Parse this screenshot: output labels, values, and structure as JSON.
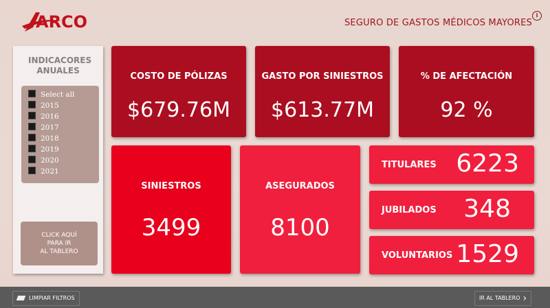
{
  "header": {
    "logo_text": "ARCO",
    "title": "SEGURO DE GASTOS MÉDICOS MAYORES",
    "info_icon": "info-icon"
  },
  "colors": {
    "dark": "#ab0e20",
    "red": "#e8001d",
    "pink": "#f01f3d",
    "brand": "#c1121c"
  },
  "sidebar": {
    "title": "INDICACORES ANUALES",
    "slicer": [
      "Select all",
      "2015",
      "2016",
      "2017",
      "2018",
      "2019",
      "2020",
      "2021"
    ],
    "go_button": "CLICK AQUÍ\nPARA IR\nAL TABLERO"
  },
  "kpis": {
    "costo": {
      "label": "COSTO DE PÓLIZAS",
      "value": "$679.76M"
    },
    "gasto": {
      "label": "GASTO POR SINIESTROS",
      "value": "$613.77M"
    },
    "afectacion": {
      "label": "% DE AFECTACIÓN",
      "value": "92 %"
    },
    "siniestros": {
      "label": "SINIESTROS",
      "value": "3499"
    },
    "asegurados": {
      "label": "ASEGURADOS",
      "value": "8100"
    },
    "titulares": {
      "label": "TITULARES",
      "value": "6223"
    },
    "jubilados": {
      "label": "JUBILADOS",
      "value": "348"
    },
    "voluntarios": {
      "label": "VOLUNTARIOS",
      "value": "1529"
    }
  },
  "footer": {
    "clear_label": "LIMPIAR FILTROS",
    "go_label": "IR AL TABLERO"
  }
}
